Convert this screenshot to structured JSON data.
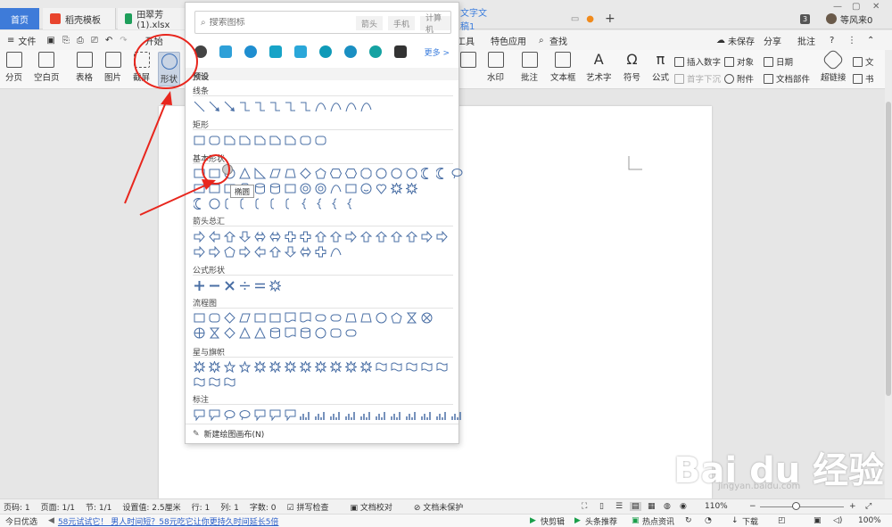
{
  "tabs": {
    "home": "首页",
    "template": "稻壳模板",
    "sheet": "田翠芳(1).xlsx",
    "doc": "文字文稿1",
    "add": "+",
    "badge": "3",
    "user": "等风来0"
  },
  "menu": {
    "file": "文件",
    "start": "开始",
    "tools": "工具",
    "special": "特色应用",
    "find": "查找",
    "unsaved": "未保存",
    "share": "分享",
    "comment": "批注",
    "help": "?"
  },
  "ribbon": {
    "page_break": "分页",
    "blank_page": "空白页",
    "table": "表格",
    "picture": "图片",
    "screenshot": "截屏",
    "shape": "形状",
    "watermark": "水印",
    "comment": "批注",
    "textbox": "文本框",
    "art": "艺术字",
    "symbol": "符号",
    "formula": "公式",
    "insert_number": "插入数字",
    "object": "对象",
    "date": "日期",
    "first_letter": "首字下沉",
    "attachment": "附件",
    "doc_parts": "文档部件",
    "hyperlink": "超链接",
    "text": "文",
    "book": "书"
  },
  "panel": {
    "search_placeholder": "搜索图标",
    "tag_arrow": "箭头",
    "tag_phone": "手机",
    "tag_computer": "计算机",
    "more": "更多 >",
    "sections": {
      "preset": "预设",
      "lines": "线条",
      "rect": "矩形",
      "basic": "基本形状",
      "arrows": "箭头总汇",
      "formula": "公式形状",
      "flow": "流程图",
      "stars": "星与旗帜",
      "callout": "标注"
    },
    "tooltip": "椭圆",
    "footer": "新建绘图画布(N)"
  },
  "status": {
    "page_no": "页码: 1",
    "pages": "页面: 1/1",
    "section": "节: 1/1",
    "setting": "设置值: 2.5厘米",
    "row": "行: 1",
    "col": "列: 1",
    "words": "字数: 0",
    "spell": "拼写检查",
    "proof": "文档校对",
    "protect": "文档未保护",
    "zoom": "110%"
  },
  "taskbar": {
    "today": "今日优选",
    "ad": "58元试试它！ 男人时间短？58元吃它让你更持久时间延长5倍",
    "fast": "快剪辑",
    "headline": "头条推荐",
    "news": "热点资讯",
    "download": "下载",
    "zoom": "100%"
  },
  "watermark": {
    "brand": "Bai du 经验",
    "url": "jingyan.baidu.com"
  },
  "colors": {
    "home_tab": "#3e7bd9",
    "annotation_red": "#e8261d",
    "link_blue": "#3b7ddd"
  }
}
